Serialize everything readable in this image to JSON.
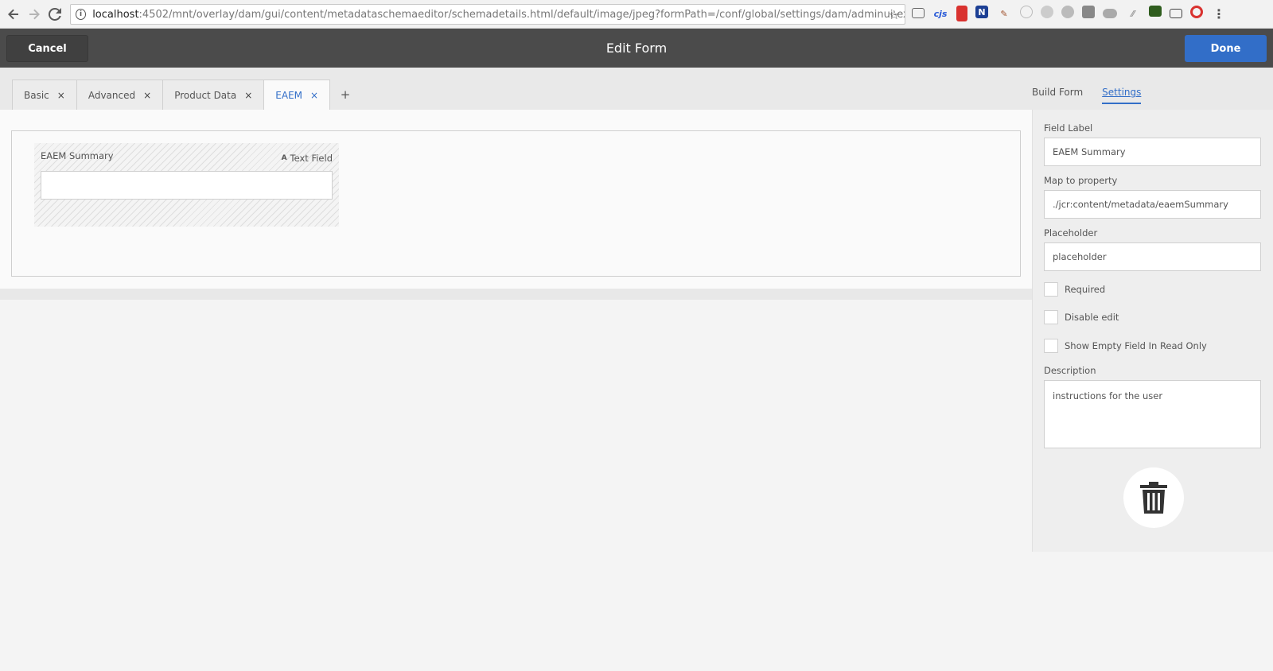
{
  "browser": {
    "url_host": "localhost",
    "url_path": ":4502/mnt/overlay/dam/gui/content/metadataschemaeditor/schemadetails.html/default/image/jpeg?formPath=/conf/global/settings/dam/adminui-extension/m"
  },
  "header": {
    "cancel_label": "Cancel",
    "title": "Edit Form",
    "done_label": "Done"
  },
  "tabs": [
    {
      "label": "Basic"
    },
    {
      "label": "Advanced"
    },
    {
      "label": "Product Data"
    },
    {
      "label": "EAEM"
    }
  ],
  "tab_add": "+",
  "tab_close": "×",
  "side_tabs": {
    "build_form": "Build Form",
    "settings": "Settings"
  },
  "canvas": {
    "field_label": "EAEM Summary",
    "field_type": "Text Field",
    "field_type_icon": "A"
  },
  "settings": {
    "field_label_title": "Field Label",
    "field_label_value": "EAEM Summary",
    "map_title": "Map to property",
    "map_value": "./jcr:content/metadata/eaemSummary",
    "placeholder_title": "Placeholder",
    "placeholder_value": "placeholder",
    "required_label": "Required",
    "disable_edit_label": "Disable edit",
    "show_empty_label": "Show Empty Field In Read Only",
    "description_title": "Description",
    "description_value": "instructions for the user"
  }
}
